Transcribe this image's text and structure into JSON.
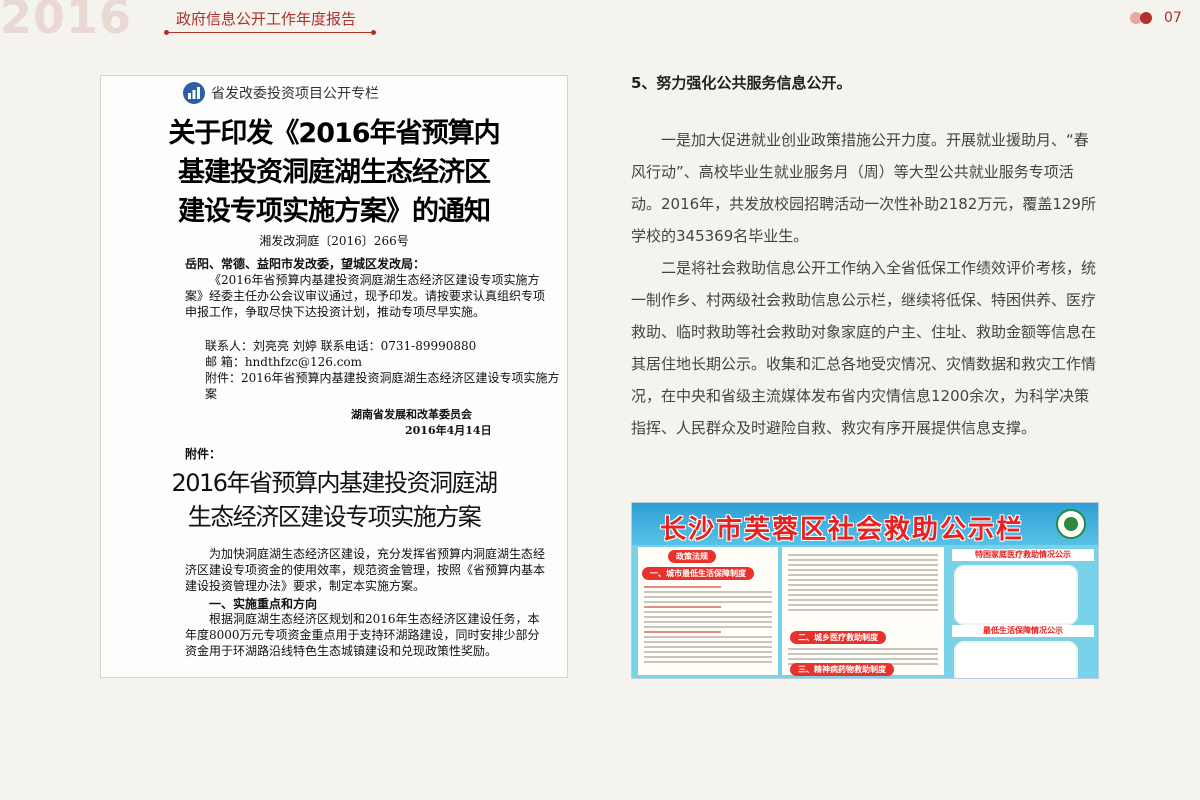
{
  "header": {
    "year": "2016",
    "report_title": "政府信息公开工作年度报告",
    "page_number": "07"
  },
  "document_image": {
    "column_header": "省发改委投资项目公开专栏",
    "headline": [
      "关于印发《2016年省预算内",
      "基建投资洞庭湖生态经济区",
      "建设专项实施方案》的通知"
    ],
    "doc_number": "湘发改洞庭〔2016〕266号",
    "addressee": "岳阳、常德、益阳市发改委，望城区发改局：",
    "para1": "《2016年省预算内基建投资洞庭湖生态经济区建设专项实施方案》经委主任办公会议审议通过，现予印发。请按要求认真组织专项申报工作，争取尽快下达投资计划，推动专项尽早实施。",
    "contact_line": "联系人：刘亮亮  刘婷  联系电话：0731-89990880",
    "email_line": "邮    箱：hndthfzc@126.com",
    "attachment_line": "附件：2016年省预算内基建投资洞庭湖生态经济区建设专项实施方案",
    "signature": "湖南省发展和改革委员会",
    "date": "2016年4月14日",
    "attachment_label": "附件：",
    "subheadline": [
      "2016年省预算内基建投资洞庭湖",
      "生态经济区建设专项实施方案"
    ],
    "para2": "为加快洞庭湖生态经济区建设，充分发挥省预算内洞庭湖生态经济区建设专项资金的使用效率，规范资金管理，按照《省预算内基本建设投资管理办法》要求，制定本实施方案。",
    "section1": "一、实施重点和方向",
    "para3": "根据洞庭湖生态经济区规划和2016年生态经济区建设任务，本年度8000万元专项资金重点用于支持环湖路建设，同时安排少部分资金用于环湖路沿线特色生态城镇建设和兑现政策性奖励。"
  },
  "article": {
    "heading": "5、努力强化公共服务信息公开。",
    "paragraphs": [
      "一是加大促进就业创业政策措施公开力度。开展就业援助月、“春风行动”、高校毕业生就业服务月（周）等大型公共就业服务专项活动。2016年，共发放校园招聘活动一次性补助2182万元，覆盖129所学校的345369名毕业生。",
      "二是将社会救助信息公开工作纳入全省低保工作绩效评价考核，统一制作乡、村两级社会救助信息公示栏，继续将低保、特困供养、医疗救助、临时救助等社会救助对象家庭的户主、住址、救助金额等信息在其居住地长期公示。收集和汇总各地受灾情况、灾情数据和救灾工作情况，在中央和省级主流媒体发布省内灾情信息1200余次，为科学决策指挥、人民群众及时避险自救、救灾有序开展提供信息支撑。"
    ]
  },
  "bulletin_image": {
    "title": "长沙市芙蓉区社会救助公示栏",
    "section_policy": "政策法规",
    "section_1": "一、城市最低生活保障制度",
    "section_2": "二、城乡医疗救助制度",
    "section_3": "三、精神病药物救助制度",
    "right_head_1": "特困家庭医疗救助情况公示",
    "right_head_2": "最低生活保障情况公示"
  }
}
